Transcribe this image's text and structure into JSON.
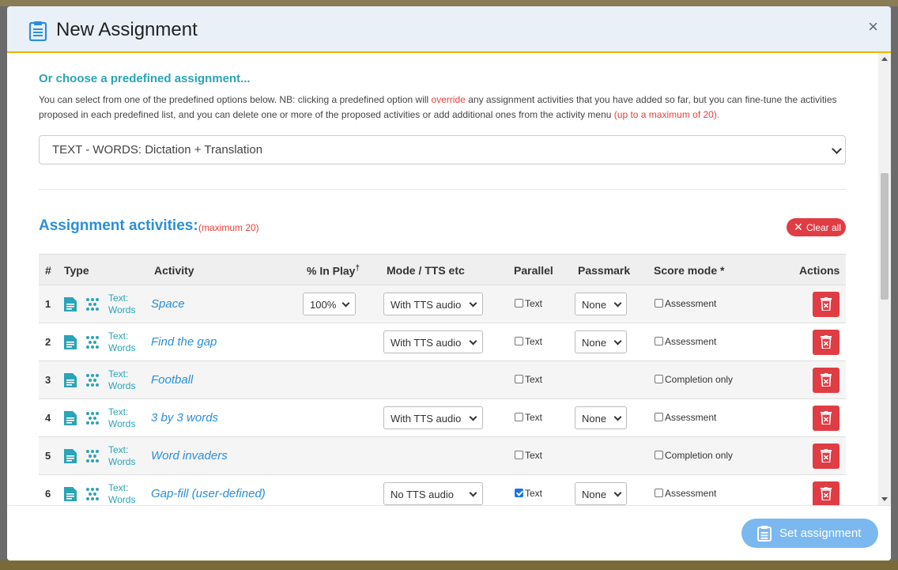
{
  "modal": {
    "title": "New Assignment",
    "close_label": "×"
  },
  "predefined": {
    "heading": "Or choose a predefined assignment...",
    "desc_part1": "You can select from one of the predefined options below. NB: clicking a predefined option will ",
    "desc_override": "override",
    "desc_part2": " any assignment activities that you have added so far, but you can fine-tune the activities proposed in each predefined list, and you can delete one or more of the proposed activities or add additional ones from the activity menu ",
    "desc_max": "(up to a maximum of 20).",
    "selected": "TEXT - WORDS: Dictation + Translation"
  },
  "activities": {
    "heading": "Assignment activities:",
    "maximum": "(maximum 20)",
    "clear_all": "Clear all",
    "columns": {
      "num": "#",
      "type": "Type",
      "activity": "Activity",
      "in_play": "% In Play",
      "in_play_mark": "†",
      "mode": "Mode / TTS etc",
      "parallel": "Parallel",
      "passmark": "Passmark",
      "score_mode": "Score mode *",
      "actions": "Actions"
    },
    "rows": [
      {
        "num": "1",
        "type_line1": "Text:",
        "type_line2": "Words",
        "activity": "Space",
        "in_play": "100%",
        "mode": "With TTS audio",
        "parallel": "Text",
        "parallel_checked": false,
        "passmark": "None",
        "score_mode": "Assessment"
      },
      {
        "num": "2",
        "type_line1": "Text:",
        "type_line2": "Words",
        "activity": "Find the gap",
        "in_play": "",
        "mode": "With TTS audio",
        "parallel": "Text",
        "parallel_checked": false,
        "passmark": "None",
        "score_mode": "Assessment"
      },
      {
        "num": "3",
        "type_line1": "Text:",
        "type_line2": "Words",
        "activity": "Football",
        "in_play": "",
        "mode": "",
        "parallel": "Text",
        "parallel_checked": false,
        "passmark": "",
        "score_mode": "Completion only"
      },
      {
        "num": "4",
        "type_line1": "Text:",
        "type_line2": "Words",
        "activity": "3 by 3 words",
        "in_play": "",
        "mode": "With TTS audio",
        "parallel": "Text",
        "parallel_checked": false,
        "passmark": "None",
        "score_mode": "Assessment"
      },
      {
        "num": "5",
        "type_line1": "Text:",
        "type_line2": "Words",
        "activity": "Word invaders",
        "in_play": "",
        "mode": "",
        "parallel": "Text",
        "parallel_checked": false,
        "passmark": "",
        "score_mode": "Completion only"
      },
      {
        "num": "6",
        "type_line1": "Text:",
        "type_line2": "Words",
        "activity": "Gap-fill (user-defined)",
        "in_play": "",
        "mode": "No TTS audio",
        "parallel": "Text",
        "parallel_checked": true,
        "passmark": "None",
        "score_mode": "Assessment"
      }
    ]
  },
  "footer": {
    "set_assignment": "Set assignment"
  },
  "icons": {
    "header": "clipboard-icon",
    "close": "close-icon",
    "type_doc": "document-icon",
    "type_dots": "dots-grid-icon",
    "delete": "trash-icon"
  },
  "colors": {
    "accent": "#2b8fd8",
    "teal": "#2aa4b8",
    "danger": "#e03c44",
    "header_bg": "#e9f0f8",
    "header_border": "#f0b400"
  }
}
